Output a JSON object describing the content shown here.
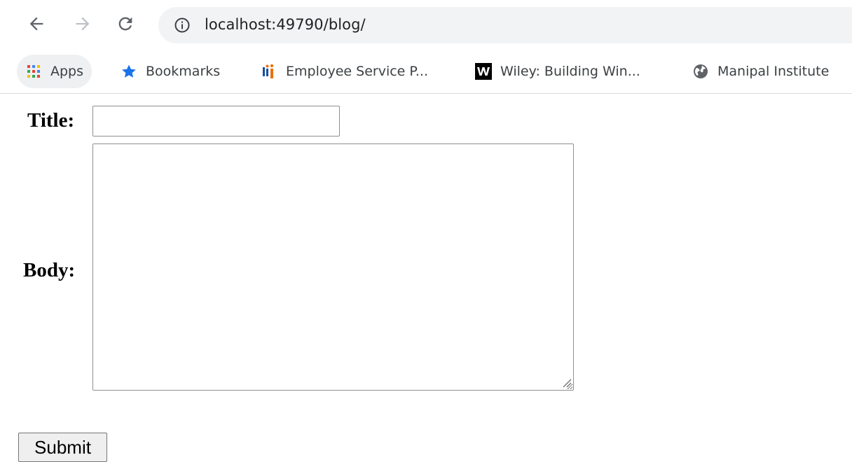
{
  "browser": {
    "url": "localhost:49790/blog/",
    "nav": {
      "back_icon": "arrow-left-icon",
      "forward_icon": "arrow-right-icon",
      "reload_icon": "reload-icon",
      "site_info_icon": "info-circle-icon"
    },
    "bookmarks": [
      {
        "label": "Apps",
        "icon": "apps-grid-icon"
      },
      {
        "label": "Bookmarks",
        "icon": "star-icon",
        "icon_color": "#1a73e8"
      },
      {
        "label": "Employee Service P...",
        "icon": "employee-service-icon"
      },
      {
        "label": "Wiley: Building Win...",
        "icon": "wiley-w-icon"
      },
      {
        "label": "Manipal Institute",
        "icon": "globe-icon"
      }
    ]
  },
  "form": {
    "title_label": "Title:",
    "title_value": "",
    "body_label": "Body:",
    "body_value": "",
    "submit_label": "Submit"
  }
}
